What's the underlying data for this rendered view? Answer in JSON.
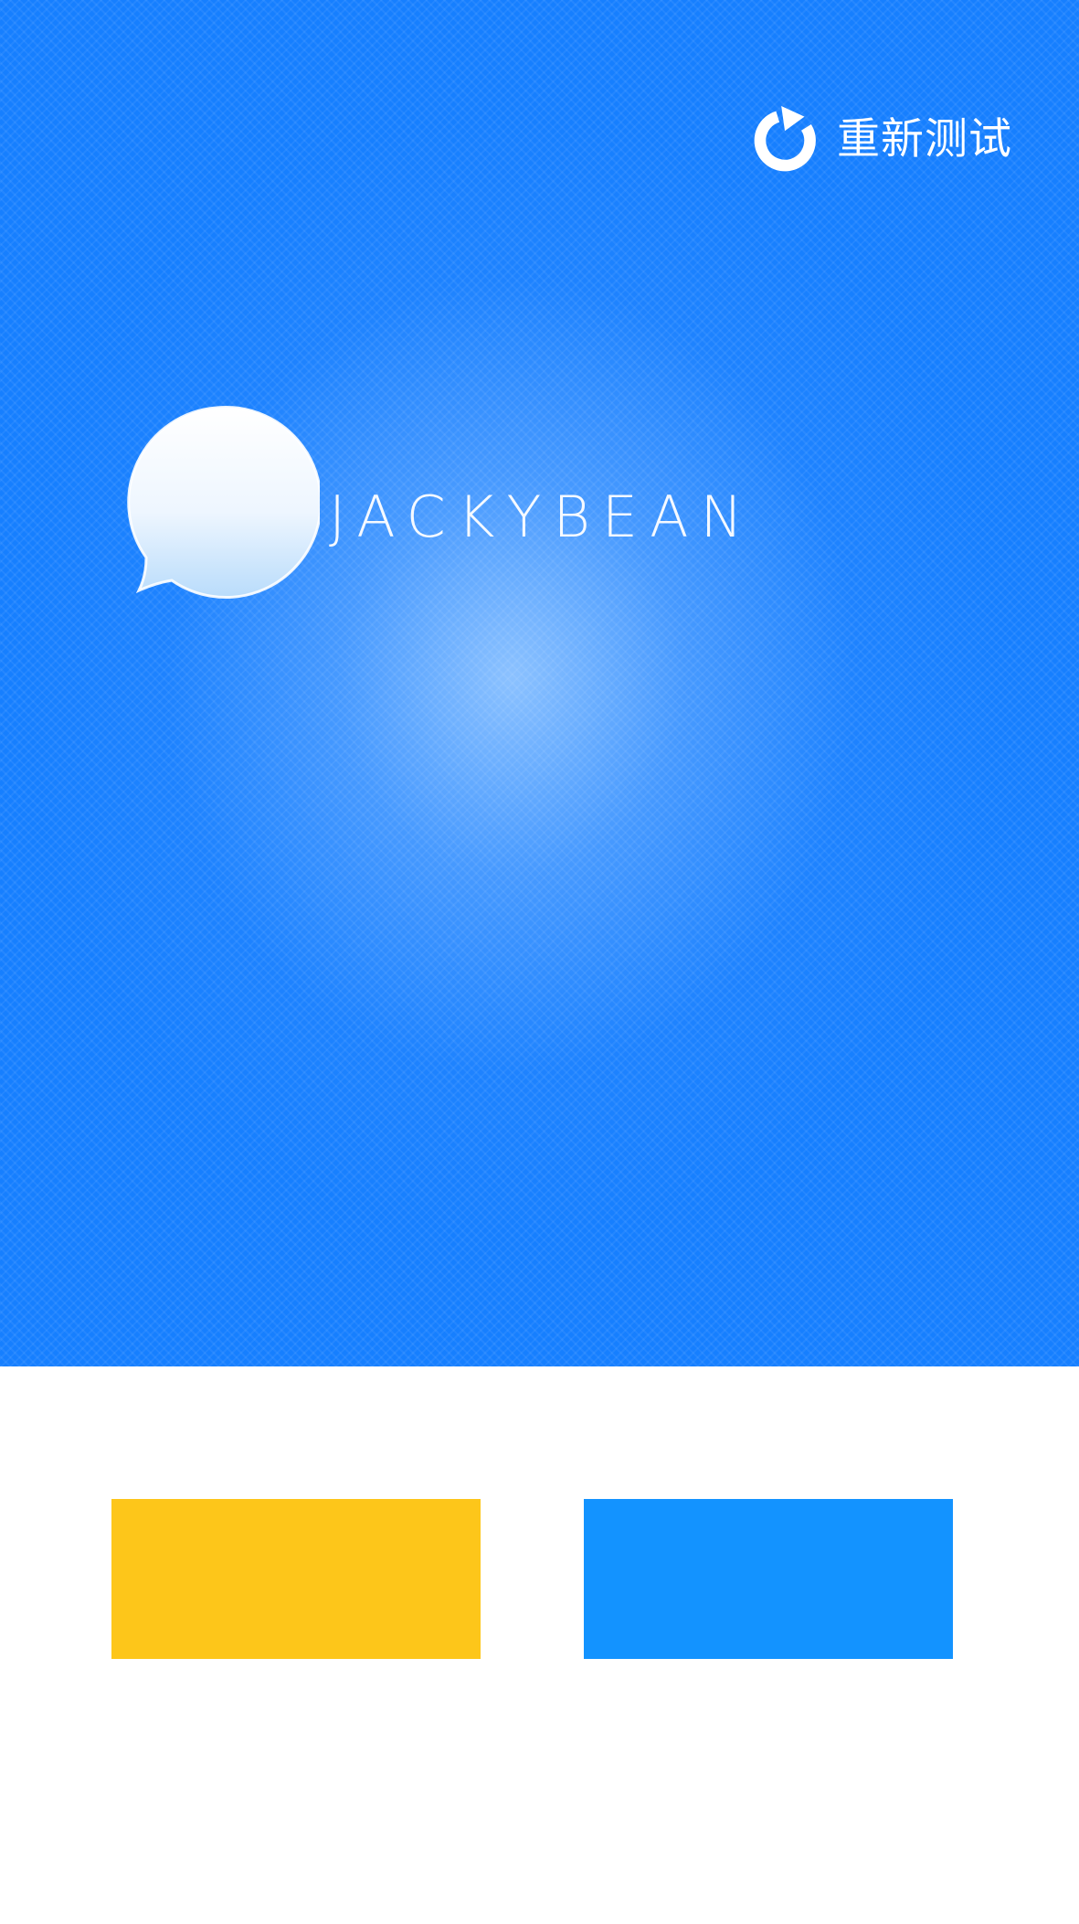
{
  "header": {
    "retest_label": "重新测试",
    "retest_icon": "refresh-icon"
  },
  "brand": {
    "logo_icon": "chat-bubble-icon",
    "name": "JACKYBEAN"
  },
  "options": [
    {
      "color": "#fdc61a"
    },
    {
      "color": "#1393ff"
    }
  ],
  "colors": {
    "hero_background": "#167fff",
    "page_background": "#ffffff"
  }
}
